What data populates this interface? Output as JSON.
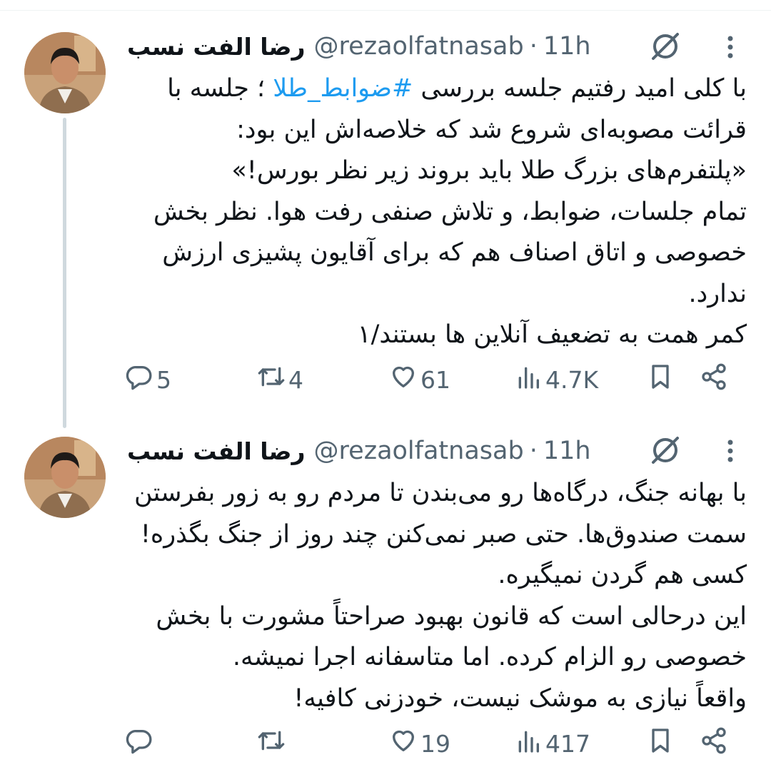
{
  "tweets": [
    {
      "author_name": "رضا الفت نسب",
      "handle": "@rezaolfatnasab",
      "separator": "·",
      "time": "11h",
      "lines": [
        {
          "before": "با کلی امید رفتیم جلسه بررسی ",
          "hashtag": "#ضوابط_طلا",
          "after": " ؛ جلسه با"
        },
        {
          "text": "قرائت مصوبه‌ای شروع شد که خلاصه‌اش این بود:"
        },
        {
          "text": "«پلتفرم‌های بزرگ طلا باید بروند زیر نظر بورس!»"
        },
        {
          "text": "تمام جلسات، ضوابط، و تلاش صنفی رفت هوا. نظر بخش"
        },
        {
          "text": "خصوصی و اتاق اصناف هم که برای آقایون پشیزی ارزش"
        },
        {
          "text": "ندارد."
        },
        {
          "text": "کمر همت به تضعیف آنلاین ها بستند/۱"
        }
      ],
      "stats": {
        "replies": "5",
        "retweets": "4",
        "likes": "61",
        "views": "4.7K"
      }
    },
    {
      "author_name": "رضا الفت نسب",
      "handle": "@rezaolfatnasab",
      "separator": "·",
      "time": "11h",
      "lines": [
        {
          "text": "با بهانه جنگ، درگاه‌ها رو می‌بندن تا مردم رو به زور بفرستن"
        },
        {
          "text": "سمت صندوق‌ها. حتی صبر نمی‌کنن چند روز از جنگ بگذره!"
        },
        {
          "text": "کسی هم گردن نمیگیره."
        },
        {
          "text": "این درحالی است که قانون بهبود صراحتاً مشورت با بخش"
        },
        {
          "text": "خصوصی رو الزام کرده. اما متاسفانه اجرا نمیشه."
        },
        {
          "text": "واقعاً نیازی به موشک نیست، خودزنی کافیه!"
        }
      ],
      "stats": {
        "replies": "",
        "retweets": "",
        "likes": "19",
        "views": "417"
      }
    }
  ],
  "icons": {
    "reply": "reply-icon",
    "retweet": "retweet-icon",
    "like": "heart-icon",
    "views": "views-icon",
    "bookmark": "bookmark-icon",
    "share": "share-icon",
    "grok": "grok-icon",
    "more": "more-icon"
  },
  "colors": {
    "link": "#1d9bf0",
    "muted": "#536471",
    "thread_line": "#cfd9de"
  }
}
